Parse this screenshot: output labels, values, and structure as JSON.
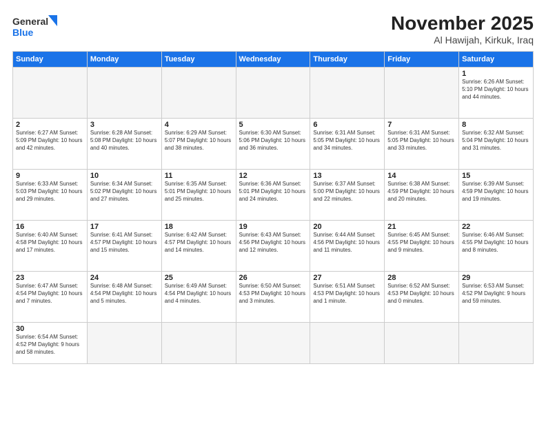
{
  "logo": {
    "line1": "General",
    "line2": "Blue"
  },
  "title": "November 2025",
  "subtitle": "Al Hawijah, Kirkuk, Iraq",
  "weekdays": [
    "Sunday",
    "Monday",
    "Tuesday",
    "Wednesday",
    "Thursday",
    "Friday",
    "Saturday"
  ],
  "weeks": [
    [
      {
        "day": "",
        "info": ""
      },
      {
        "day": "",
        "info": ""
      },
      {
        "day": "",
        "info": ""
      },
      {
        "day": "",
        "info": ""
      },
      {
        "day": "",
        "info": ""
      },
      {
        "day": "",
        "info": ""
      },
      {
        "day": "1",
        "info": "Sunrise: 6:26 AM\nSunset: 5:10 PM\nDaylight: 10 hours and 44 minutes."
      }
    ],
    [
      {
        "day": "2",
        "info": "Sunrise: 6:27 AM\nSunset: 5:09 PM\nDaylight: 10 hours and 42 minutes."
      },
      {
        "day": "3",
        "info": "Sunrise: 6:28 AM\nSunset: 5:08 PM\nDaylight: 10 hours and 40 minutes."
      },
      {
        "day": "4",
        "info": "Sunrise: 6:29 AM\nSunset: 5:07 PM\nDaylight: 10 hours and 38 minutes."
      },
      {
        "day": "5",
        "info": "Sunrise: 6:30 AM\nSunset: 5:06 PM\nDaylight: 10 hours and 36 minutes."
      },
      {
        "day": "6",
        "info": "Sunrise: 6:31 AM\nSunset: 5:05 PM\nDaylight: 10 hours and 34 minutes."
      },
      {
        "day": "7",
        "info": "Sunrise: 6:31 AM\nSunset: 5:05 PM\nDaylight: 10 hours and 33 minutes."
      },
      {
        "day": "8",
        "info": "Sunrise: 6:32 AM\nSunset: 5:04 PM\nDaylight: 10 hours and 31 minutes."
      }
    ],
    [
      {
        "day": "9",
        "info": "Sunrise: 6:33 AM\nSunset: 5:03 PM\nDaylight: 10 hours and 29 minutes."
      },
      {
        "day": "10",
        "info": "Sunrise: 6:34 AM\nSunset: 5:02 PM\nDaylight: 10 hours and 27 minutes."
      },
      {
        "day": "11",
        "info": "Sunrise: 6:35 AM\nSunset: 5:01 PM\nDaylight: 10 hours and 25 minutes."
      },
      {
        "day": "12",
        "info": "Sunrise: 6:36 AM\nSunset: 5:01 PM\nDaylight: 10 hours and 24 minutes."
      },
      {
        "day": "13",
        "info": "Sunrise: 6:37 AM\nSunset: 5:00 PM\nDaylight: 10 hours and 22 minutes."
      },
      {
        "day": "14",
        "info": "Sunrise: 6:38 AM\nSunset: 4:59 PM\nDaylight: 10 hours and 20 minutes."
      },
      {
        "day": "15",
        "info": "Sunrise: 6:39 AM\nSunset: 4:59 PM\nDaylight: 10 hours and 19 minutes."
      }
    ],
    [
      {
        "day": "16",
        "info": "Sunrise: 6:40 AM\nSunset: 4:58 PM\nDaylight: 10 hours and 17 minutes."
      },
      {
        "day": "17",
        "info": "Sunrise: 6:41 AM\nSunset: 4:57 PM\nDaylight: 10 hours and 15 minutes."
      },
      {
        "day": "18",
        "info": "Sunrise: 6:42 AM\nSunset: 4:57 PM\nDaylight: 10 hours and 14 minutes."
      },
      {
        "day": "19",
        "info": "Sunrise: 6:43 AM\nSunset: 4:56 PM\nDaylight: 10 hours and 12 minutes."
      },
      {
        "day": "20",
        "info": "Sunrise: 6:44 AM\nSunset: 4:56 PM\nDaylight: 10 hours and 11 minutes."
      },
      {
        "day": "21",
        "info": "Sunrise: 6:45 AM\nSunset: 4:55 PM\nDaylight: 10 hours and 9 minutes."
      },
      {
        "day": "22",
        "info": "Sunrise: 6:46 AM\nSunset: 4:55 PM\nDaylight: 10 hours and 8 minutes."
      }
    ],
    [
      {
        "day": "23",
        "info": "Sunrise: 6:47 AM\nSunset: 4:54 PM\nDaylight: 10 hours and 7 minutes."
      },
      {
        "day": "24",
        "info": "Sunrise: 6:48 AM\nSunset: 4:54 PM\nDaylight: 10 hours and 5 minutes."
      },
      {
        "day": "25",
        "info": "Sunrise: 6:49 AM\nSunset: 4:54 PM\nDaylight: 10 hours and 4 minutes."
      },
      {
        "day": "26",
        "info": "Sunrise: 6:50 AM\nSunset: 4:53 PM\nDaylight: 10 hours and 3 minutes."
      },
      {
        "day": "27",
        "info": "Sunrise: 6:51 AM\nSunset: 4:53 PM\nDaylight: 10 hours and 1 minute."
      },
      {
        "day": "28",
        "info": "Sunrise: 6:52 AM\nSunset: 4:53 PM\nDaylight: 10 hours and 0 minutes."
      },
      {
        "day": "29",
        "info": "Sunrise: 6:53 AM\nSunset: 4:52 PM\nDaylight: 9 hours and 59 minutes."
      }
    ],
    [
      {
        "day": "30",
        "info": "Sunrise: 6:54 AM\nSunset: 4:52 PM\nDaylight: 9 hours and 58 minutes."
      },
      {
        "day": "",
        "info": ""
      },
      {
        "day": "",
        "info": ""
      },
      {
        "day": "",
        "info": ""
      },
      {
        "day": "",
        "info": ""
      },
      {
        "day": "",
        "info": ""
      },
      {
        "day": "",
        "info": ""
      }
    ]
  ]
}
